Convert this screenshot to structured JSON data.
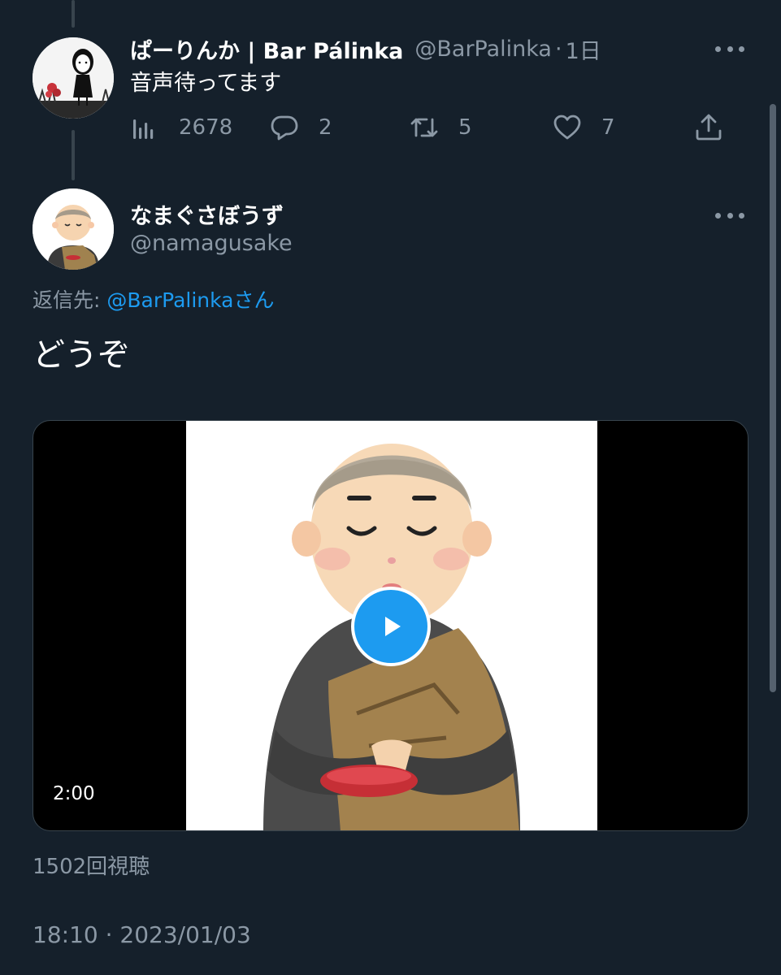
{
  "tweet1": {
    "display_name": "ぱーりんか | Bar Pálinka",
    "handle": "@BarPalinka",
    "separator": "·",
    "time": "1日",
    "text": "音声待ってます",
    "stats": {
      "views": "2678",
      "replies": "2",
      "retweets": "5",
      "likes": "7"
    }
  },
  "tweet2": {
    "display_name": "なまぐさぼうず",
    "handle": "@namagusake",
    "reply_to_prefix": "返信先: ",
    "reply_to_mention": "@BarPalinka",
    "reply_to_suffix": "さん",
    "text": "どうぞ",
    "video": {
      "duration": "2:00"
    },
    "views_text": "1502回視聴",
    "timestamp": "18:10 · 2023/01/03"
  },
  "colors": {
    "background": "#15202b",
    "secondary_text": "#8b98a5",
    "accent": "#1d9bf0"
  },
  "icons": [
    "views-icon",
    "reply-icon",
    "retweet-icon",
    "like-icon",
    "share-icon",
    "more-icon",
    "play-icon"
  ]
}
